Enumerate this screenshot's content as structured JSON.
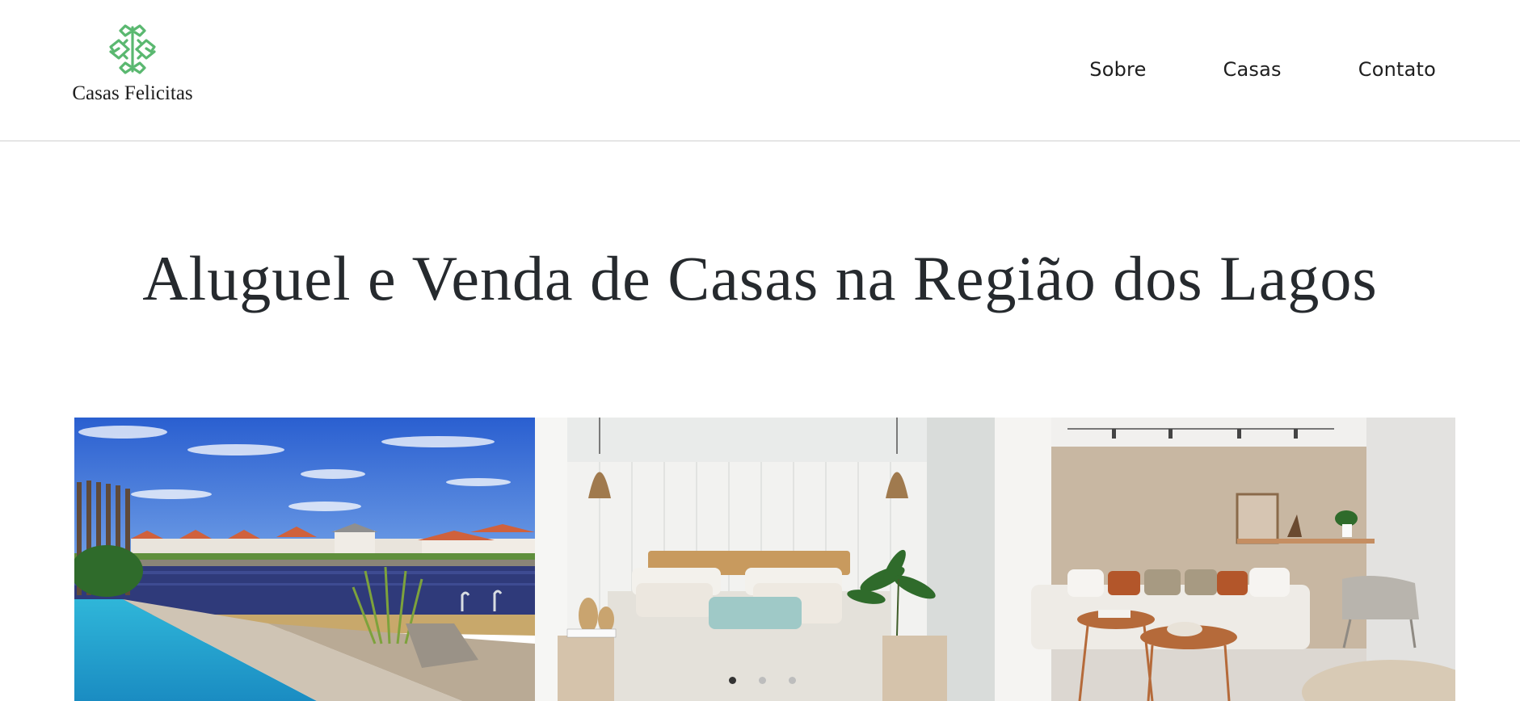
{
  "brand": {
    "name": "Casas Felicitas",
    "logo_icon": "ornament-logo-icon",
    "accent_color": "#5ab870"
  },
  "nav": {
    "items": [
      {
        "label": "Sobre"
      },
      {
        "label": "Casas"
      },
      {
        "label": "Contato"
      }
    ]
  },
  "hero": {
    "title": "Aluguel e Venda de Casas na Região dos Lagos"
  },
  "gallery": {
    "images": [
      {
        "name": "pool-canal-photo"
      },
      {
        "name": "bedroom-photo"
      },
      {
        "name": "living-room-photo"
      }
    ],
    "dots": 3,
    "active_dot": 1
  }
}
